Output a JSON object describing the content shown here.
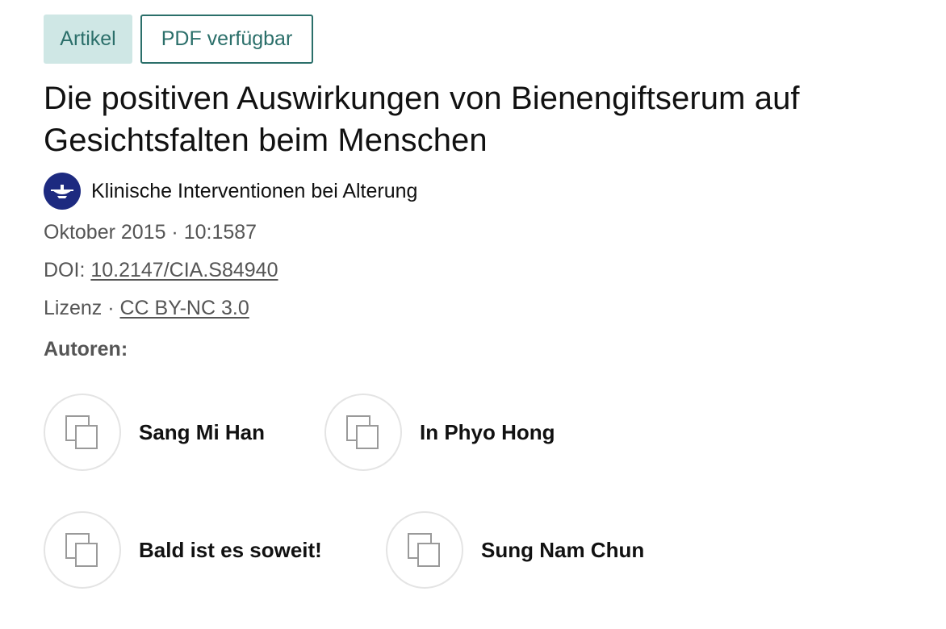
{
  "badges": {
    "type_label": "Artikel",
    "pdf_label": "PDF verfügbar"
  },
  "article": {
    "title_line1": "Die positiven Auswirkungen von Bienengiftserum auf",
    "title_line2": "Gesichtsfalten beim Menschen",
    "journal": "Klinische Interventionen bei Alterung",
    "date_volume": "Oktober 2015 · 10:1587",
    "doi_label": "DOI: ",
    "doi": "10.2147/CIA.S84940",
    "license_label": "Lizenz · ",
    "license": "CC BY-NC 3.0"
  },
  "authors": {
    "label": "Autoren:",
    "items": [
      {
        "name": "Sang Mi Han"
      },
      {
        "name": "In Phyo Hong"
      },
      {
        "name": "Bald ist es soweit!"
      },
      {
        "name": "Sung Nam Chun"
      }
    ]
  },
  "colors": {
    "accent": "#2b6f6a",
    "badge_bg": "#cfe7e5",
    "journal_logo": "#1d2a80",
    "muted_text": "#555555"
  },
  "icons": {
    "journal_logo": "journal-logo-icon",
    "avatar_placeholder": "author-placeholder-icon"
  }
}
